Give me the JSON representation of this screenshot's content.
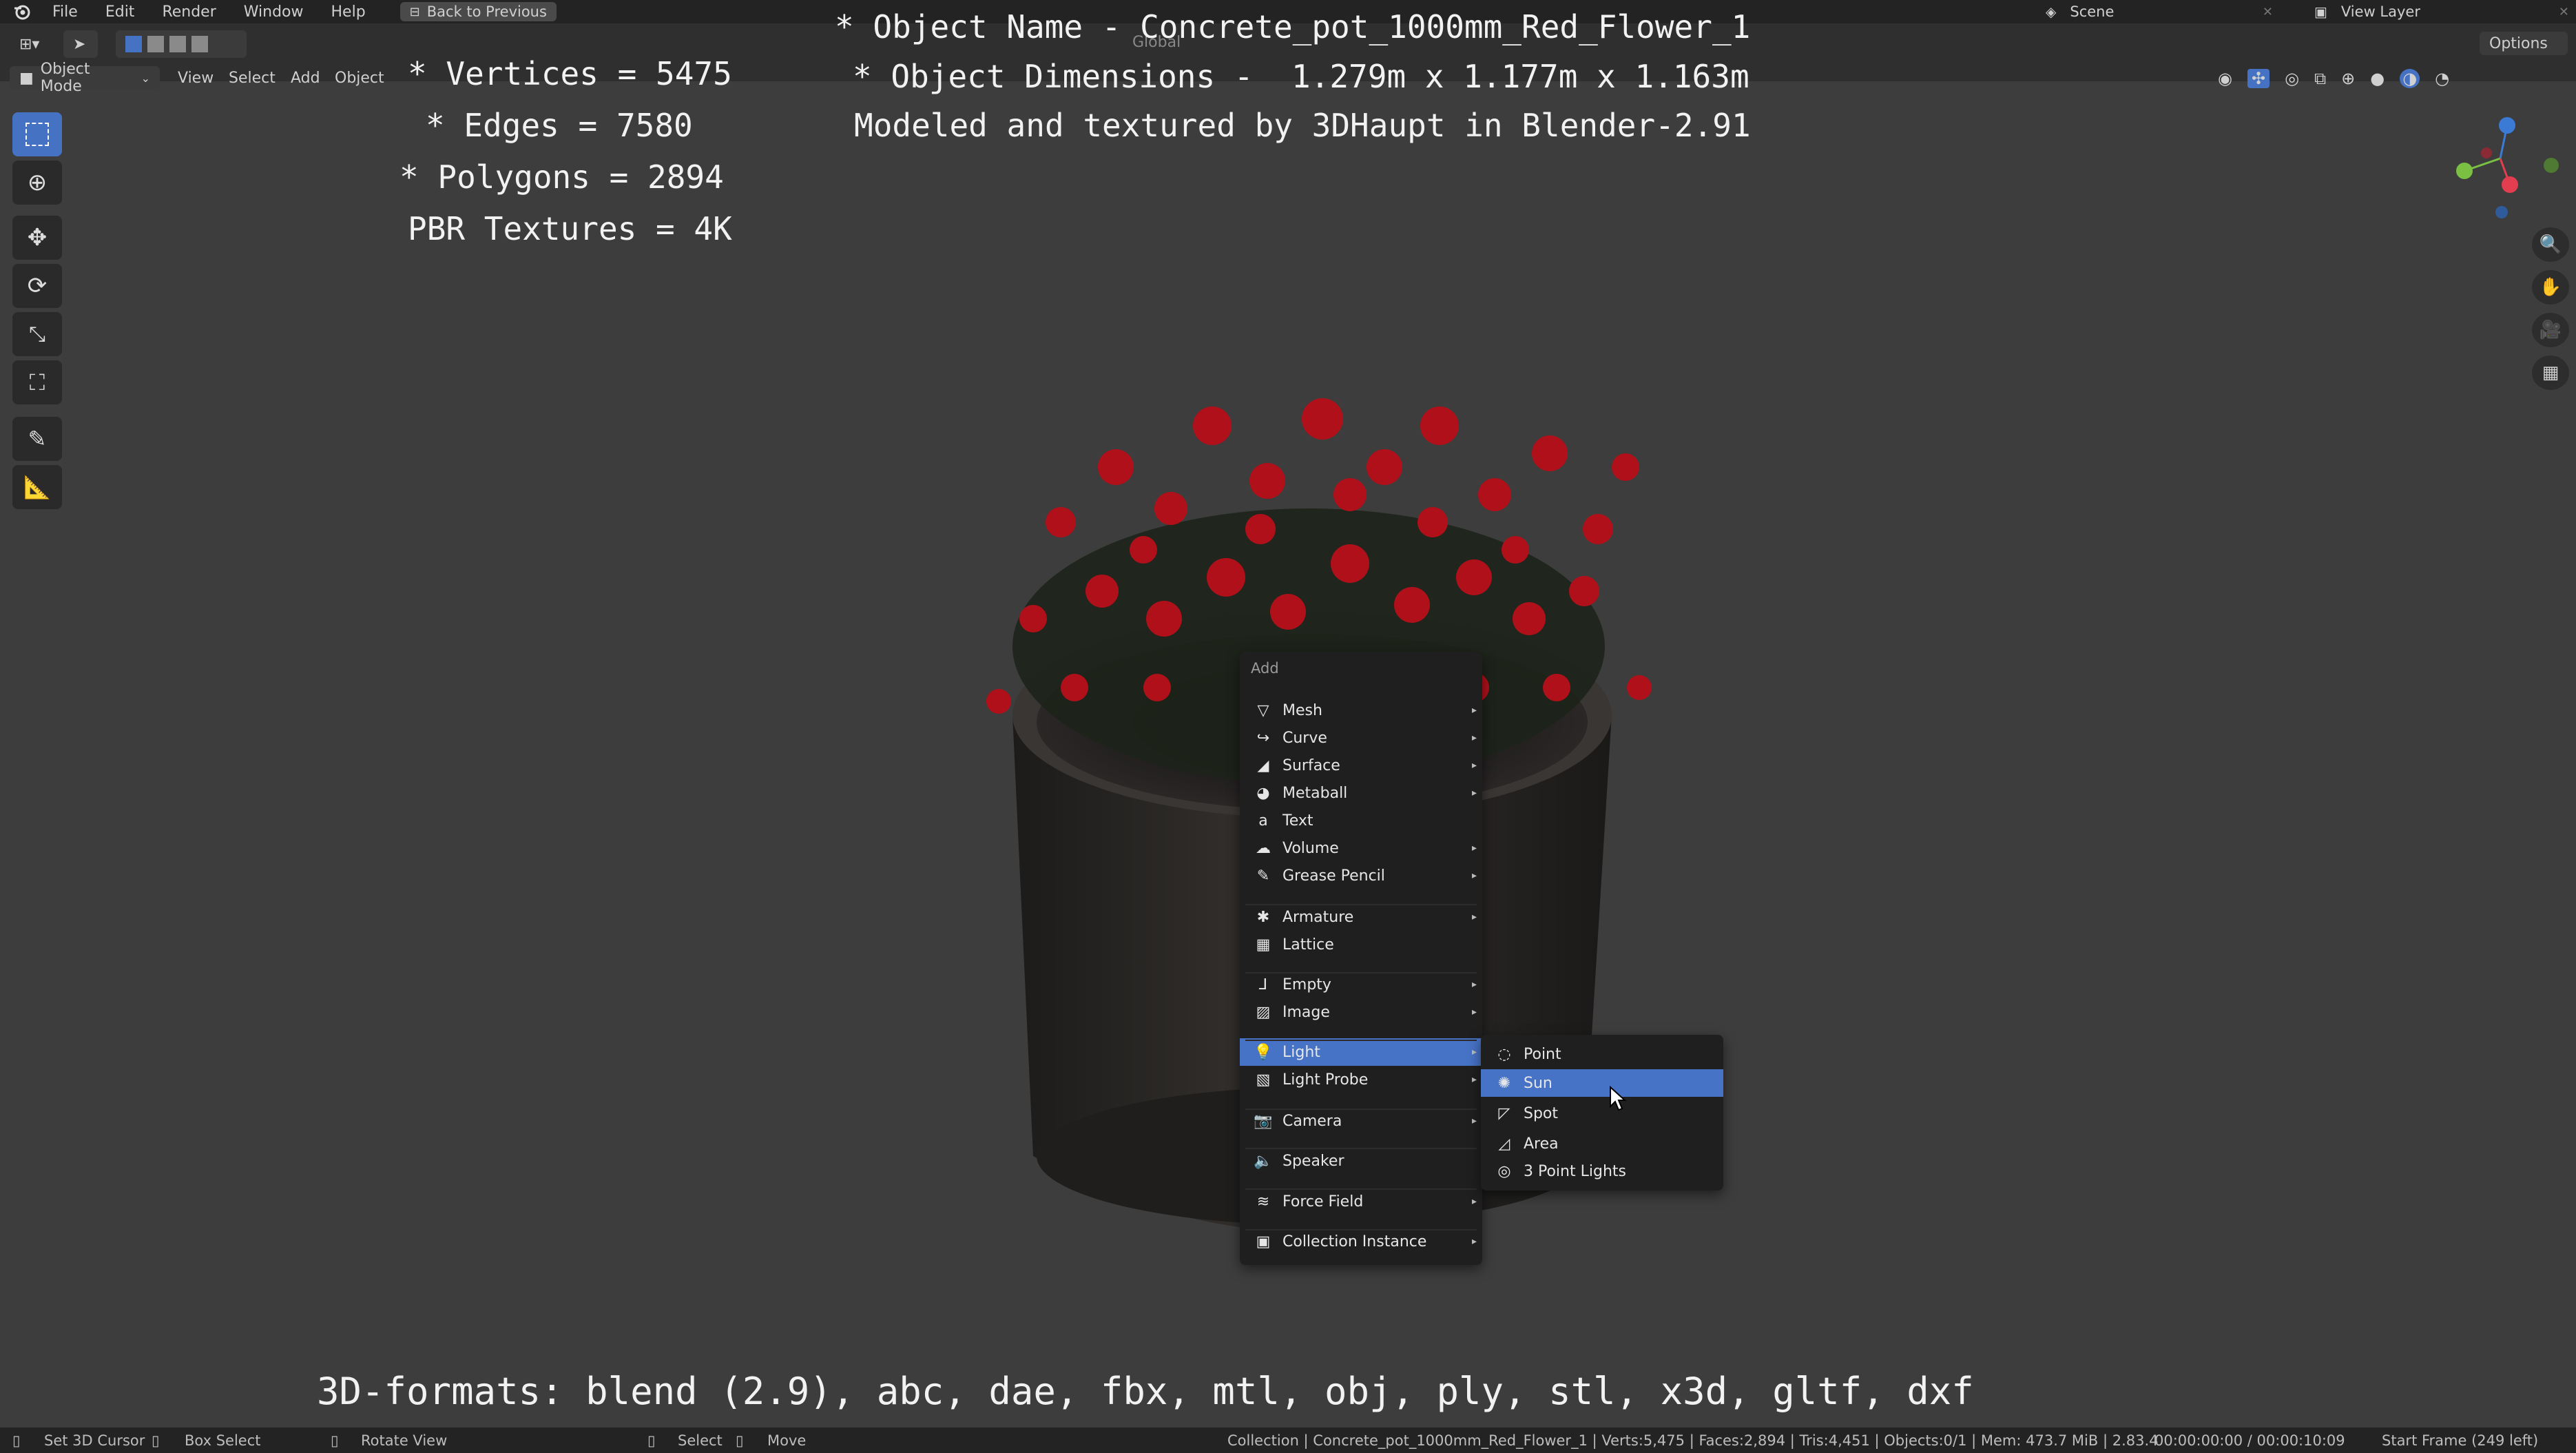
{
  "topbar": {
    "menus": [
      "File",
      "Edit",
      "Render",
      "Window",
      "Help"
    ],
    "back_button": "Back to Previous",
    "scene_label": "Scene",
    "view_layer_label": "View Layer"
  },
  "header": {
    "mode": "Object Mode",
    "menus": [
      "View",
      "Select",
      "Add",
      "Object"
    ],
    "orientation": "Global",
    "options": "Options"
  },
  "overlay": {
    "vertices": "* Vertices = 5475",
    "edges": "* Edges = 7580",
    "polygons": "* Polygons = 2894",
    "textures": "PBR Textures = 4K",
    "object_name": "* Object Name - Concrete_pot_1000mm_Red_Flower_1",
    "dimensions": "* Object Dimensions -  1.279m x 1.177m x 1.163m",
    "credit": "Modeled and textured by 3DHaupt in Blender-2.91",
    "formats": "3D-formats: blend (2.9), abc, dae, fbx, mtl, obj, ply, stl, x3d, gltf, dxf"
  },
  "add_menu": {
    "title": "Add",
    "items": [
      {
        "label": "Mesh",
        "icon": "mesh-icon"
      },
      {
        "label": "Curve",
        "icon": "curve-icon"
      },
      {
        "label": "Surface",
        "icon": "surface-icon"
      },
      {
        "label": "Metaball",
        "icon": "metaball-icon"
      },
      {
        "label": "Text",
        "icon": "text-icon"
      },
      {
        "label": "Volume",
        "icon": "volume-icon"
      },
      {
        "label": "Grease Pencil",
        "icon": "grease-pencil-icon"
      },
      {
        "label": "Armature",
        "icon": "armature-icon"
      },
      {
        "label": "Lattice",
        "icon": "lattice-icon"
      },
      {
        "label": "Empty",
        "icon": "empty-icon"
      },
      {
        "label": "Image",
        "icon": "image-icon"
      },
      {
        "label": "Light",
        "icon": "light-icon"
      },
      {
        "label": "Light Probe",
        "icon": "light-probe-icon"
      },
      {
        "label": "Camera",
        "icon": "camera-icon"
      },
      {
        "label": "Speaker",
        "icon": "speaker-icon"
      },
      {
        "label": "Force Field",
        "icon": "force-field-icon"
      },
      {
        "label": "Collection Instance",
        "icon": "collection-instance-icon"
      }
    ]
  },
  "light_submenu": {
    "items": [
      {
        "label": "Point",
        "icon": "point-light-icon"
      },
      {
        "label": "Sun",
        "icon": "sun-light-icon"
      },
      {
        "label": "Spot",
        "icon": "spot-light-icon"
      },
      {
        "label": "Area",
        "icon": "area-light-icon"
      },
      {
        "label": "3 Point Lights",
        "icon": "three-point-lights-icon"
      }
    ]
  },
  "status": {
    "set_cursor": "Set 3D Cursor",
    "box_select": "Box Select",
    "rotate_view": "Rotate View",
    "select": "Select",
    "move": "Move",
    "stats": "Collection | Concrete_pot_1000mm_Red_Flower_1 | Verts:5,475 | Faces:2,894 | Tris:4,451 | Objects:0/1 | Mem: 473.7 MiB | 2.83.4",
    "time": "00:00:00:00 / 00:00:10:09",
    "frame": "Start Frame (249 left)"
  },
  "colors": {
    "highlight": "#4773c6",
    "flower": "#b0101a",
    "pot": "#2c2a28"
  }
}
